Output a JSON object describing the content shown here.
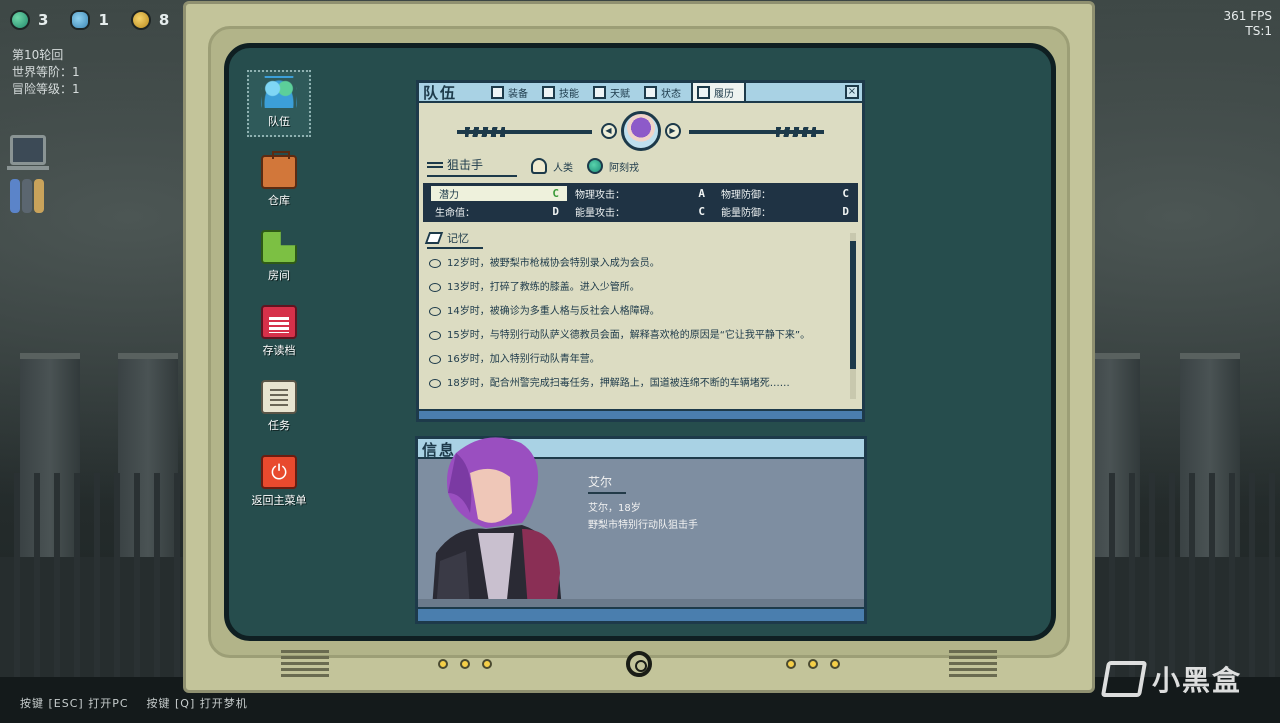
{
  "hud": {
    "resources": [
      {
        "icon": "globe-icon",
        "value": "3"
      },
      {
        "icon": "people-icon",
        "value": "1"
      },
      {
        "icon": "coin-icon",
        "value": "8"
      }
    ],
    "round": "第10轮回",
    "world_level": "世界等阶：1",
    "adventure_level": "冒险等级：1",
    "fps": "361 FPS",
    "ts": "TS:1"
  },
  "hints": [
    "按键 [ESC] 打开PC",
    "按键 [Q] 打开梦机"
  ],
  "watermark": "小黑盒",
  "desktop": [
    {
      "id": "team",
      "label": "队伍",
      "icon": "team-icon",
      "active": true
    },
    {
      "id": "storage",
      "label": "仓库",
      "icon": "storage-icon"
    },
    {
      "id": "room",
      "label": "房间",
      "icon": "room-icon"
    },
    {
      "id": "save",
      "label": "存读档",
      "icon": "save-icon"
    },
    {
      "id": "quest",
      "label": "任务",
      "icon": "quest-icon"
    },
    {
      "id": "menu",
      "label": "返回主菜单",
      "icon": "power-icon"
    }
  ],
  "team_window": {
    "title": "队伍",
    "tabs": [
      "装备",
      "技能",
      "天赋",
      "状态",
      "履历"
    ],
    "active_tab": "履历",
    "close": "×",
    "character": {
      "role": "狙击手",
      "race": "人类",
      "faction": "阿刻戎"
    },
    "stats": [
      {
        "label": "潜力",
        "grade": "C"
      },
      {
        "label": "物理攻击：",
        "grade": "A"
      },
      {
        "label": "物理防御：",
        "grade": "C"
      },
      {
        "label": "生命值：",
        "grade": "D"
      },
      {
        "label": "能量攻击：",
        "grade": "C"
      },
      {
        "label": "能量防御：",
        "grade": "D"
      }
    ],
    "memory_title": "记忆",
    "memories": [
      "12岁时，被野梨市枪械协会特别录入成为会员。",
      "13岁时，打碎了教练的膝盖。进入少管所。",
      "14岁时，被确诊为多重人格与反社会人格障碍。",
      "15岁时，与特别行动队萨义德教员会面，解释喜欢枪的原因是“它让我平静下来”。",
      "16岁时，加入特别行动队青年营。",
      "18岁时，配合州警完成扫毒任务，押解路上，国道被连绵不断的车辆堵死……"
    ]
  },
  "info_window": {
    "title": "信息",
    "name": "艾尔",
    "age_line": "艾尔，18岁",
    "desc_line": "野梨市特别行动队狙击手"
  }
}
